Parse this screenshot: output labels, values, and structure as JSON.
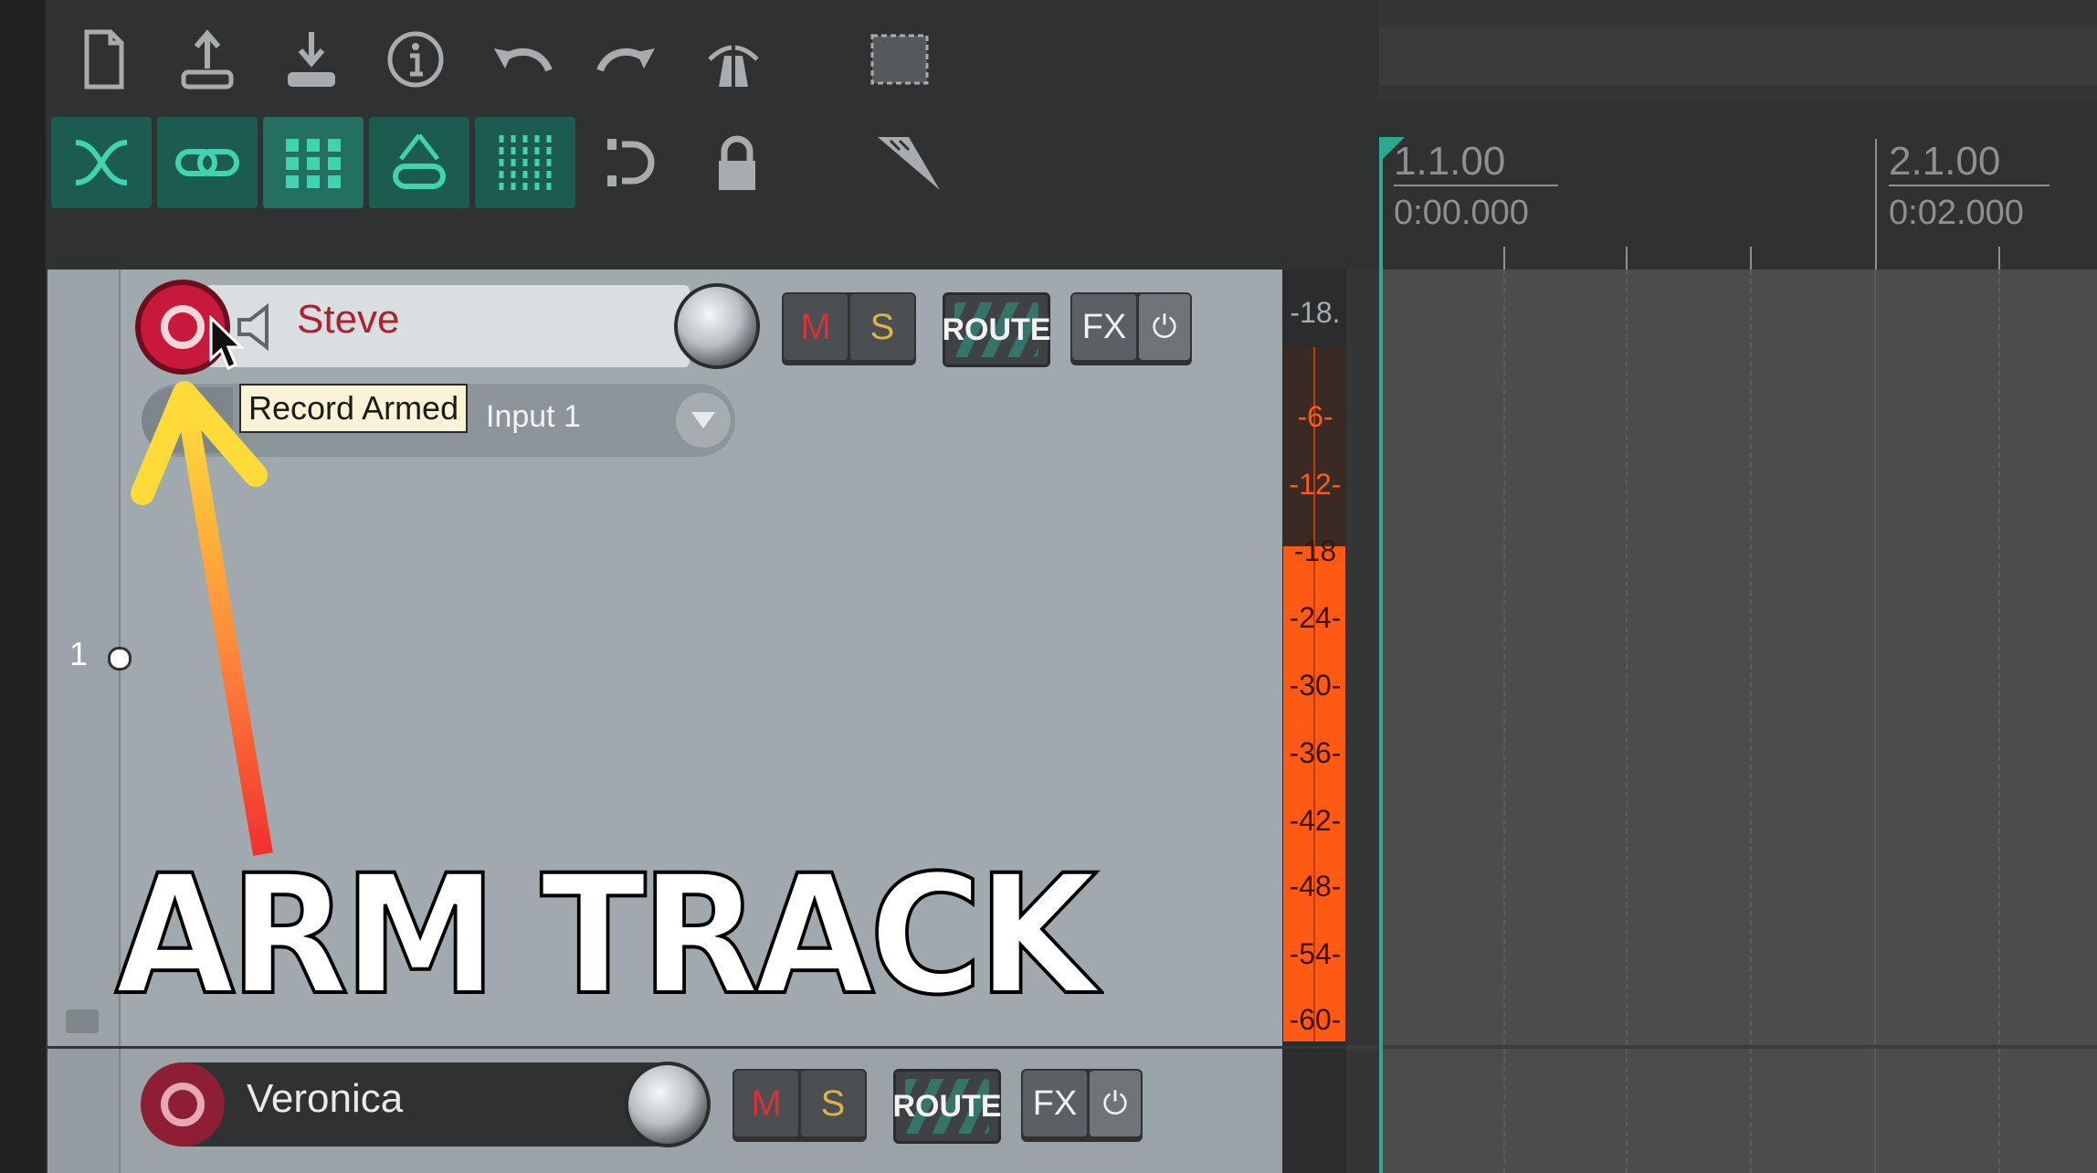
{
  "toolbar": {
    "row1": [
      "new-project-icon",
      "import-icon",
      "export-icon",
      "info-icon",
      "undo-icon",
      "redo-icon",
      "metronome-icon",
      "marquee-icon"
    ],
    "row2": [
      "crossfade-icon",
      "link-icon",
      "snap-grid-icon",
      "ripple-icon",
      "grid-lines-icon",
      "loop-icon",
      "lock-icon",
      "trim-icon"
    ]
  },
  "ruler": {
    "marker1_bar": "1.1.00",
    "marker1_time": "0:00.000",
    "marker2_bar": "2.1.00",
    "marker2_time": "0:02.000"
  },
  "track1": {
    "number": "1",
    "name": "Steve",
    "input": "Input 1",
    "mute_label": "M",
    "solo_label": "S",
    "route_label": "ROUTE",
    "fx_label": "FX",
    "power_glyph": "⏻",
    "record_armed": true
  },
  "track2": {
    "name": "Veronica",
    "mute_label": "M",
    "solo_label": "S",
    "route_label": "ROUTE",
    "fx_label": "FX",
    "power_glyph": "⏻"
  },
  "meter": {
    "labels": [
      "-18.",
      "-6-",
      "-12-",
      "-18",
      "-24-",
      "-30-",
      "-36-",
      "-42-",
      "-48-",
      "-54-",
      "-60-"
    ],
    "color": "#ff5a14"
  },
  "tooltip": "Record Armed",
  "overlay_text": "ARM TRACK",
  "colors": {
    "accent": "#2aa891",
    "record": "#c8193d",
    "meter": "#ff5a14"
  }
}
